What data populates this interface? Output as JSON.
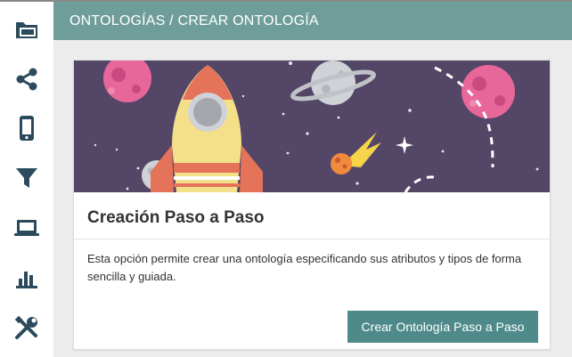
{
  "sidebar": {
    "items": [
      {
        "icon": "folder-icon"
      },
      {
        "icon": "share-network-icon"
      },
      {
        "icon": "mobile-phone-icon"
      },
      {
        "icon": "filter-icon"
      },
      {
        "icon": "laptop-icon"
      },
      {
        "icon": "bar-chart-icon"
      },
      {
        "icon": "tools-icon"
      }
    ],
    "icon_color": "#2b4a5c"
  },
  "header": {
    "breadcrumb": "ONTOLOGÍAS / CREAR ONTOLOGÍA"
  },
  "card": {
    "title": "Creación Paso a Paso",
    "description": "Esta opción permite crear una ontología especificando sus atributos y tipos de forma sencilla y guiada.",
    "button_label": "Crear Ontología Paso a Paso"
  },
  "colors": {
    "header_bg": "#6f9e9a",
    "button_bg": "#4f8a8b",
    "hero_bg": "#534666"
  }
}
